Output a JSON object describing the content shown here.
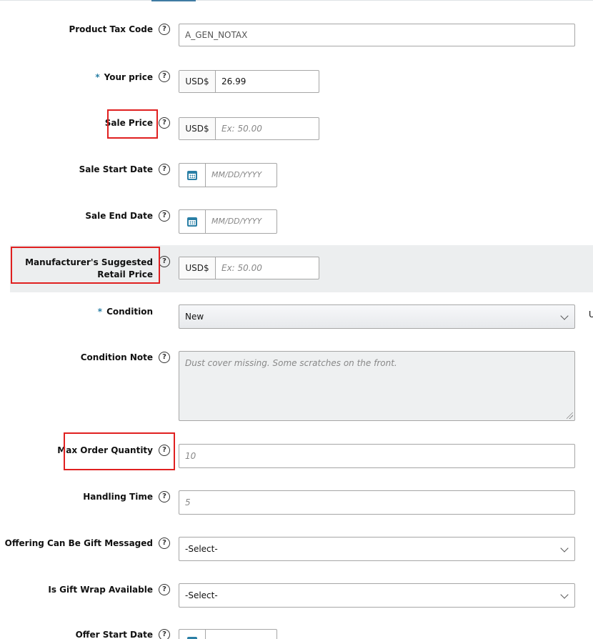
{
  "fields": {
    "product_tax_code": {
      "label": "Product Tax Code",
      "value": "A_GEN_NOTAX"
    },
    "your_price": {
      "required_mark": "*",
      "label": "Your price",
      "currency": "USD$",
      "value": "26.99"
    },
    "sale_price": {
      "label": "Sale Price",
      "currency": "USD$",
      "placeholder": "Ex: 50.00"
    },
    "sale_start_date": {
      "label": "Sale Start Date",
      "placeholder": "MM/DD/YYYY"
    },
    "sale_end_date": {
      "label": "Sale End Date",
      "placeholder": "MM/DD/YYYY"
    },
    "msrp": {
      "label": "Manufacturer's Suggested Retail Price",
      "currency": "USD$",
      "placeholder": "Ex: 50.00"
    },
    "condition": {
      "required_mark": "*",
      "label": "Condition",
      "selected": "New"
    },
    "condition_note": {
      "label": "Condition Note",
      "placeholder": "Dust cover missing. Some scratches on the front."
    },
    "max_order_quantity": {
      "label": "Max Order Quantity",
      "placeholder": "10"
    },
    "handling_time": {
      "label": "Handling Time",
      "placeholder": "5"
    },
    "gift_message": {
      "label": "Offering Can Be Gift Messaged",
      "selected": "-Select-"
    },
    "gift_wrap": {
      "label": "Is Gift Wrap Available",
      "selected": "-Select-"
    },
    "offer_start_date": {
      "label": "Offer Start Date"
    }
  },
  "help_glyph": "?",
  "edge_glyph": "U",
  "colors": {
    "accent": "#2a7fa5",
    "highlight": "#e02020",
    "band": "#eceeef"
  },
  "icons": [
    "help-icon",
    "calendar-icon",
    "chevron-down-icon"
  ]
}
